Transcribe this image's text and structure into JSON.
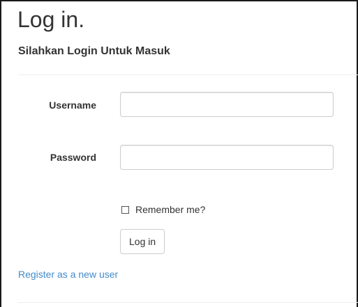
{
  "page": {
    "title": "Log in.",
    "subtitle": "Silahkan Login Untuk Masuk"
  },
  "form": {
    "username_label": "Username",
    "username_value": "",
    "password_label": "Password",
    "password_value": "",
    "remember_label": "Remember me?",
    "remember_checked": false,
    "submit_label": "Log in"
  },
  "links": {
    "register": "Register as a new user"
  },
  "colors": {
    "link": "#428bca",
    "text": "#333333",
    "input_border": "#cccccc"
  }
}
